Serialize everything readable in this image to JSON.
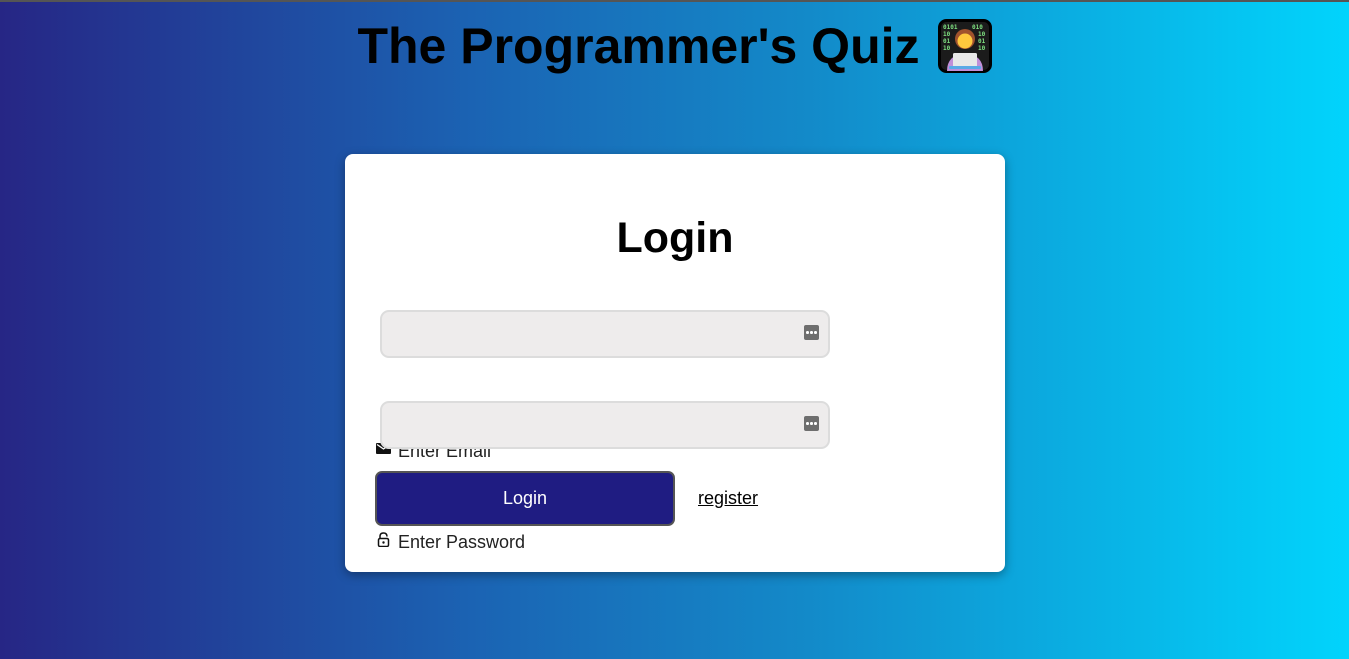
{
  "header": {
    "title": "The Programmer's Quiz",
    "icon": "technologist-emoji-icon"
  },
  "login_card": {
    "title": "Login",
    "email": {
      "label": "Enter Email",
      "icon": "mail-icon",
      "value": "",
      "placeholder": ""
    },
    "password": {
      "label": "Enter Password",
      "icon": "lock-icon",
      "value": "",
      "placeholder": ""
    },
    "login_button_label": "Login",
    "register_link_label": "register"
  },
  "colors": {
    "gradient_start": "#262685",
    "gradient_end": "#01d4fc",
    "button_bg": "#1f1c82",
    "card_bg": "#ffffff",
    "input_bg": "#eeecec"
  }
}
